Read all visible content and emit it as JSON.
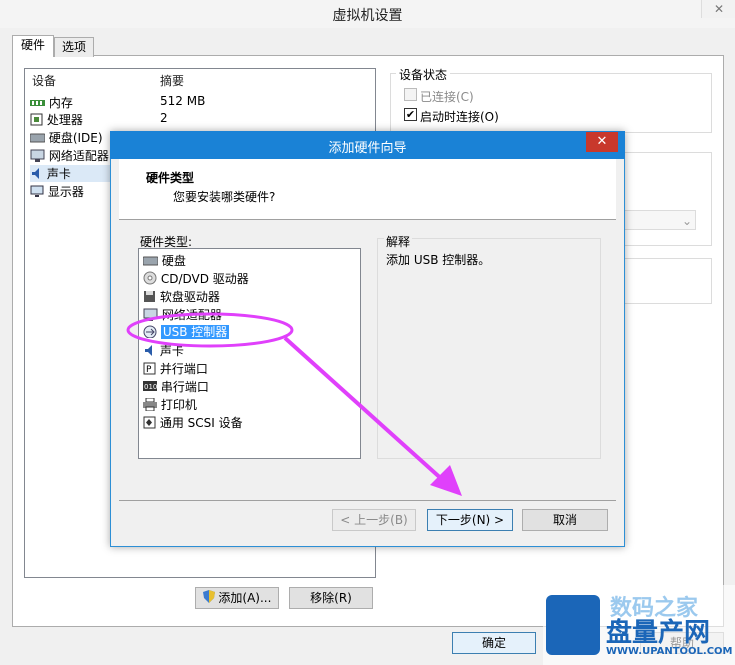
{
  "outer": {
    "title": "虚拟机设置",
    "tabs": [
      "硬件",
      "选项"
    ],
    "columns": {
      "device": "设备",
      "summary": "摘要"
    },
    "devices": [
      {
        "name": "内存",
        "summary": "512 MB",
        "icon": "memory-icon"
      },
      {
        "name": "处理器",
        "summary": "2",
        "icon": "cpu-icon"
      },
      {
        "name": "硬盘(IDE)",
        "summary": "",
        "icon": "harddisk-icon"
      },
      {
        "name": "网络适配器",
        "summary": "",
        "icon": "network-icon"
      },
      {
        "name": "声卡",
        "summary": "",
        "icon": "sound-icon"
      },
      {
        "name": "显示器",
        "summary": "",
        "icon": "display-icon"
      }
    ],
    "device_status": {
      "title": "设备状态",
      "connected": "已连接(C)",
      "connect_on_start": "启动时连接(O)"
    },
    "add_label": "添加(A)...",
    "remove_label": "移除(R)",
    "ok_label": "确定",
    "help_label": "帮助"
  },
  "wizard": {
    "title": "添加硬件向导",
    "header_title": "硬件类型",
    "header_subtitle": "您要安装哪类硬件?",
    "list_label": "硬件类型:",
    "items": [
      {
        "name": "硬盘",
        "icon": "harddisk-icon"
      },
      {
        "name": "CD/DVD 驱动器",
        "icon": "cd-icon"
      },
      {
        "name": "软盘驱动器",
        "icon": "floppy-icon"
      },
      {
        "name": "网络适配器",
        "icon": "network-icon"
      },
      {
        "name": "USB 控制器",
        "icon": "usb-icon",
        "selected": true
      },
      {
        "name": "声卡",
        "icon": "sound-icon"
      },
      {
        "name": "并行端口",
        "icon": "parallel-port-icon"
      },
      {
        "name": "串行端口",
        "icon": "serial-port-icon"
      },
      {
        "name": "打印机",
        "icon": "printer-icon"
      },
      {
        "name": "通用 SCSI 设备",
        "icon": "scsi-icon"
      }
    ],
    "explanation_title": "解释",
    "explanation_text": "添加 USB 控制器。",
    "back_label": "< 上一步(B)",
    "next_label": "下一步(N) >",
    "cancel_label": "取消"
  },
  "watermark": {
    "line1": "数码之家",
    "line2": "盘量产网",
    "line3": "WWW.UPANTOOL.COM"
  },
  "colors": {
    "accent": "#1a82d6",
    "close": "#c8382c",
    "selection": "#3399ff",
    "annotation": "#e040fb"
  }
}
